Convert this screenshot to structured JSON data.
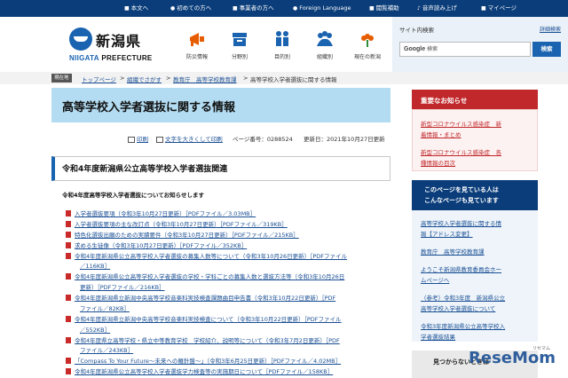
{
  "topbar": {
    "links": [
      "本文へ",
      "初めての方へ",
      "事業者の方へ",
      "Foreign Language",
      "閲覧補助",
      "音声読み上げ",
      "マイページ"
    ]
  },
  "logo": {
    "jp": "新潟県",
    "en_a": "NIIGATA",
    "en_b": "PREFECTURE"
  },
  "nav": [
    "防災情報",
    "分野別",
    "目的別",
    "組織別",
    "現在の新潟"
  ],
  "search": {
    "title": "サイト内検索",
    "help": "詳細検索",
    "brand": "Google",
    "placeholder": "検索",
    "button": "検索"
  },
  "breadcrumb": {
    "tag": "現在地",
    "items": [
      "トップページ",
      "組織でさがす",
      "教育庁　高等学校教育課",
      "高等学校入学者選抜に関する情報"
    ]
  },
  "page": {
    "title": "高等学校入学者選抜に関する情報",
    "print": "印刷",
    "font_size": "文字を大きくして印刷",
    "page_no": "ページ番号：0288524",
    "updated": "更新日：2021年10月27日更新"
  },
  "section": {
    "title": "令和4年度新潟県公立高等学校入学者選抜関連",
    "lead": "令和4年度高等学校入学者選抜についてお知らせします"
  },
  "documents": [
    "入学者選抜要項（令和3年10月27日更新）［PDFファイル／3.03MB］",
    "入学者選抜要項の主な改訂点（令和3年10月27日更新）［PDFファイル／319KB］",
    "特色化選抜出願のための実績要件（令和3年10月27日更新）［PDFファイル／215KB］",
    "求める生徒像（令和3年10月27日更新）［PDFファイル／352KB］",
    "令和4年度新潟県公立高等学校入学者選抜の募集人数等について（令和3年10月26日更新）［PDFファイル",
    "／116KB］",
    "令和4年度新潟県公立高等学校入学者選抜の学校・学科ごとの募集人数と選抜方法等（令和3年10月26日",
    "更新）［PDFファイル／216KB］",
    "令和4年度新潟県立新潟中央高等学校音楽科実技検査課題曲目申告書（令和3年10月22日更新）［PDF",
    "ファイル／82KB］",
    "令和4年度新潟県立新潟中央高等学校音楽科実技検査について（令和3年10月22日更新）［PDFファイル",
    "／552KB］",
    "令和4年度県立高等学校・県立中等教育学校　学校紹介、説明等について（令和3年7月2日更新）［PDF",
    "ファイル／243KB］",
    "「Compass To Your Future～未来への羅針盤～」（令和3年6月25日更新）［PDFファイル／4.02MB］",
    "令和4年度新潟県公立高等学校入学者選抜学力検査等の実施期日について［PDFファイル／158KB］"
  ],
  "sidebar": {
    "notice_title": "重要なお知らせ",
    "notice_links": [
      "新型コロナウイルス感染症　新",
      "着情報・まとめ",
      "新型コロナウイルス感染症　各",
      "種情報の目次"
    ],
    "viewers_title_1": "このページを見ている人は",
    "viewers_title_2": "こんなページも見ています",
    "viewer_links": [
      "高等学校入学者選抜に関する情",
      "報【アドレス変更】",
      "教育庁　高等学校教育課",
      "ようこそ新潟県教育委員会ホー",
      "ムページへ",
      "（参考）令和3年度　新潟県公立",
      "高等学校入学者選抜について",
      "令和3年度新潟県公立高等学校入",
      "学者選抜結果"
    ],
    "find_title": "見つからないときは"
  },
  "watermark": {
    "text": "ReseMom",
    "sub": "リセマム"
  },
  "colors": {
    "navy": "#0a3d7a",
    "blue": "#1a63b0",
    "title_band": "#b3dcf2",
    "alert_red": "#c0282b"
  }
}
